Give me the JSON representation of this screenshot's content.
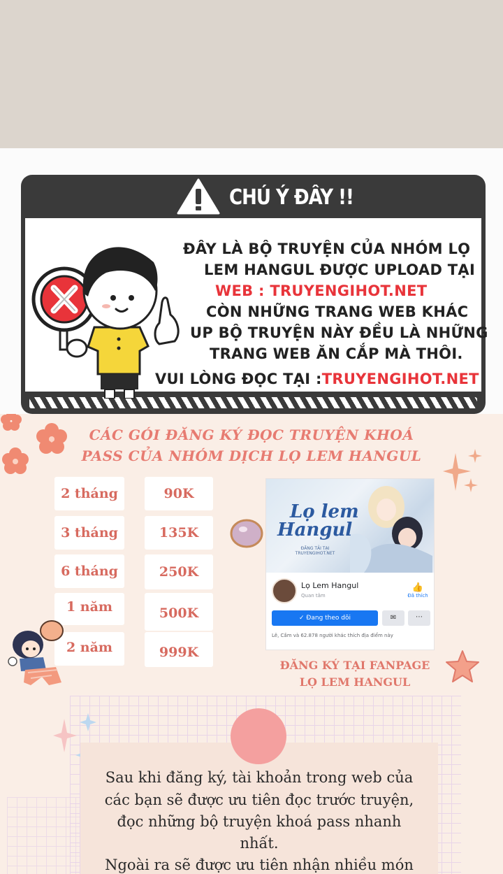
{
  "notice": {
    "title": "CHÚ Ý ĐÂY !!",
    "line1": "ĐÂY LÀ BỘ TRUYỆN CỦA NHÓM LỌ",
    "line2": "LEM HANGUL ĐƯỢC UPLOAD TẠI",
    "line3": "WEB : TRUYENGIHOT.NET",
    "line4": "CÒN NHỮNG TRANG WEB KHÁC",
    "line5": "UP BỘ TRUYỆN NÀY ĐỀU LÀ NHỮNG",
    "line6": "TRANG WEB ĂN CẮP MÀ THÔI.",
    "line7_prefix": "VUI LÒNG ĐỌC TẠI :",
    "line7_url": "TRUYENGIHOT.NET"
  },
  "subscription": {
    "title_line1": "CÁC GÓI ĐĂNG KÝ ĐỌC TRUYỆN KHOÁ",
    "title_line2": "PASS CỦA NHÓM DỊCH LỌ LEM HANGUL",
    "plans": [
      {
        "period": "2 tháng",
        "price": "90K"
      },
      {
        "period": "3 tháng",
        "price": "135K"
      },
      {
        "period": "6 tháng",
        "price": "250K"
      },
      {
        "period": "1 năm",
        "price": "500K"
      },
      {
        "period": "2 năm",
        "price": "999K"
      }
    ]
  },
  "fanpage_card": {
    "logo_line1": "Lọ lem",
    "logo_line2": "Hangul",
    "logo_sub": "ĐĂNG TẢI TẠI TRUYENGIHOT.NET",
    "page_name": "Lọ Lem Hangul",
    "category": "Quan tâm",
    "like_label": "Đã thích",
    "follow_label": "Đang theo dõi",
    "likes_text": "Lê, Cầm và 62.878 người khác thích địa điểm này"
  },
  "fanpage_caption": {
    "line1": "ĐĂNG KÝ TẠI FANPAGE",
    "line2": "LỌ LEM HANGUL"
  },
  "info": {
    "line1": "Sau khi đăng ký, tài khoản trong web của",
    "line2": "các bạn sẽ được ưu tiên đọc trước truyện,",
    "line3": "đọc những bộ truyện khoá pass nhanh",
    "line4": "nhất.",
    "line5": "Ngoài ra sẽ được ưu tiên nhận nhiều món"
  },
  "colors": {
    "accent_red": "#e8343a",
    "peach": "#e77b71",
    "facebook_blue": "#1877f2"
  }
}
